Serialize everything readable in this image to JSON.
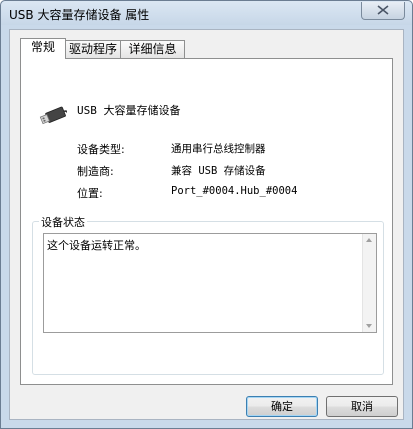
{
  "window": {
    "title": "USB 大容量存储设备 属性"
  },
  "tabs": [
    {
      "label": "常规",
      "active": true
    },
    {
      "label": "驱动程序",
      "active": false
    },
    {
      "label": "详细信息",
      "active": false
    }
  ],
  "device": {
    "icon": "usb-connector-icon",
    "name": "USB 大容量存储设备"
  },
  "properties": [
    {
      "label": "设备类型:",
      "value": "通用串行总线控制器"
    },
    {
      "label": "制造商:",
      "value": "兼容 USB 存储设备"
    },
    {
      "label": "位置:",
      "value": "Port_#0004.Hub_#0004"
    }
  ],
  "status_group": {
    "title": "设备状态",
    "text": "这个设备运转正常。"
  },
  "buttons": {
    "ok": "确定",
    "cancel": "取消"
  },
  "colors": {
    "frame": "#c9d9ea",
    "panel": "#ffffff",
    "dialog_bg": "#f0f0f0",
    "default_button_border": "#3c7fb1"
  }
}
